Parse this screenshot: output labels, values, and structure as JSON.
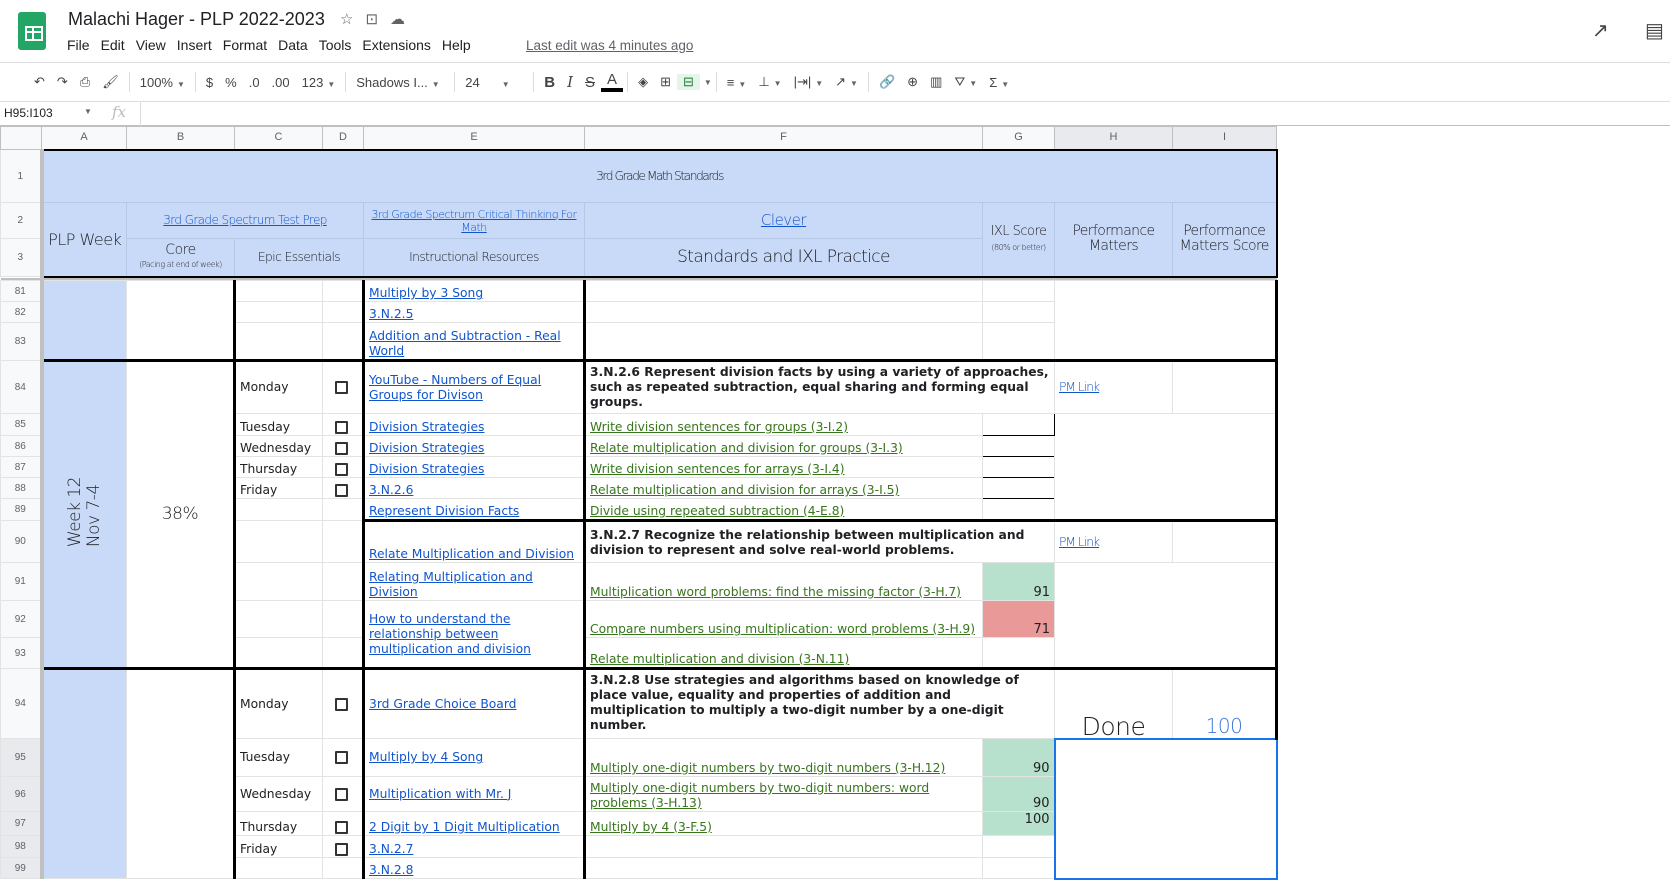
{
  "app": {
    "title": "Malachi Hager - PLP 2022-2023",
    "menus": [
      "File",
      "Edit",
      "View",
      "Insert",
      "Format",
      "Data",
      "Tools",
      "Extensions",
      "Help"
    ],
    "last_edit": "Last edit was 4 minutes ago"
  },
  "toolbar": {
    "zoom": "100%",
    "currency": "$",
    "percent": "%",
    "dec_decrease": ".0",
    "dec_increase": ".00",
    "more_formats": "123",
    "font": "Shadows I...",
    "font_size": "24",
    "bold": "B",
    "italic": "I",
    "strike": "S",
    "text_color": "A",
    "sigma": "Σ"
  },
  "formula": {
    "cell_ref": "H95:I103",
    "fx": "fx"
  },
  "columns": [
    "A",
    "B",
    "C",
    "D",
    "E",
    "F",
    "G",
    "H",
    "I"
  ],
  "header": {
    "title": "3rd Grade Math Standards",
    "plp_week": "PLP Week",
    "spectrum_test_prep": "3rd Grade Spectrum Test Prep",
    "spectrum_critical": "3rd Grade Spectrum Critical Thinking For Math",
    "clever": "Clever",
    "core": "Core",
    "core_note": "(Pacing at end of week)",
    "epic": "Epic Essentials",
    "instructional": "Instructional Resources",
    "standards": "Standards and IXL Practice",
    "ixl_score": "IXL Score",
    "ixl_note": "(80% or better)",
    "pm": "Performance Matters",
    "pm_score": "Performance Matters Score"
  },
  "week12": {
    "label": "Week 12",
    "dates": "Nov 7-4",
    "core": "38%"
  },
  "rows": {
    "r81": {
      "num": "81",
      "res": "Multiply by 3 Song"
    },
    "r82": {
      "num": "82",
      "res": "3.N.2.5"
    },
    "r83": {
      "num": "83",
      "res": "Addition and Subtraction - Real World"
    },
    "r84": {
      "num": "84",
      "day": "Monday",
      "res": "YouTube - Numbers of Equal Groups for Divison",
      "std": "3.N.2.6 Represent division facts by using a variety of approaches, such as repeated subtraction, equal sharing and forming equal groups.",
      "pm": "PM Link"
    },
    "r85": {
      "num": "85",
      "day": "Tuesday",
      "res": "Division Strategies",
      "std": "Write division sentences for groups (3-I.2)"
    },
    "r86": {
      "num": "86",
      "day": "Wednesday",
      "res": "Division Strategies",
      "std": "Relate multiplication and division for groups (3-I.3)"
    },
    "r87": {
      "num": "87",
      "day": "Thursday",
      "res": "Division Strategies",
      "std": "Write division sentences for arrays (3-I.4)"
    },
    "r88": {
      "num": "88",
      "day": "Friday",
      "res": "3.N.2.6",
      "std": "Relate multiplication and division for arrays (3-I.5)"
    },
    "r89": {
      "num": "89",
      "res": "Represent Division Facts",
      "std": "Divide using repeated subtraction (4-E.8)"
    },
    "r90": {
      "num": "90",
      "res": "Relate Multiplication and Division",
      "std": "3.N.2.7 Recognize the relationship between multiplication and division to represent and solve real-world problems.",
      "pm": "PM Link"
    },
    "r91": {
      "num": "91",
      "res": "Relating Multiplication and Division",
      "std": "Multiplication word problems: find the missing factor (3-H.7)",
      "score": "91"
    },
    "r92": {
      "num": "92",
      "res": "How to understand the relationship between multiplication and division",
      "std": "Compare numbers using multiplication: word problems (3-H.9)",
      "score": "71"
    },
    "r93": {
      "num": "93",
      "std": "Relate multiplication and division (3-N.11)"
    },
    "r94": {
      "num": "94",
      "day": "Monday",
      "res": "3rd Grade Choice Board",
      "std": "3.N.2.8 Use strategies and algorithms based on knowledge of place value, equality and properties of addition and multiplication to multiply a two-digit number by a one-digit number.",
      "pm": "Done",
      "pm_score": "100"
    },
    "r95": {
      "num": "95",
      "day": "Tuesday",
      "res": "Multiply by 4 Song",
      "std": "Multiply one-digit numbers by two-digit numbers (3-H.12)",
      "score": "90"
    },
    "r96": {
      "num": "96",
      "day": "Wednesday",
      "res": "Multiplication with Mr. J",
      "std": "Multiply one-digit numbers by two-digit numbers: word problems (3-H.13)",
      "score": "90"
    },
    "r97": {
      "num": "97",
      "day": "Thursday",
      "res": "2 Digit by 1 Digit Multiplication",
      "std": "Multiply by 4 (3-F.5)",
      "score": "100"
    },
    "r98": {
      "num": "98",
      "day": "Friday",
      "res": "3.N.2.7"
    },
    "r99": {
      "num": "99",
      "res": "3.N.2.8"
    }
  },
  "colors": {
    "header_blue": "#c9daf8",
    "score_green": "#b7e1cd",
    "score_red": "#ea9999",
    "link": "#1155cc",
    "ixl_link": "#38761d"
  }
}
